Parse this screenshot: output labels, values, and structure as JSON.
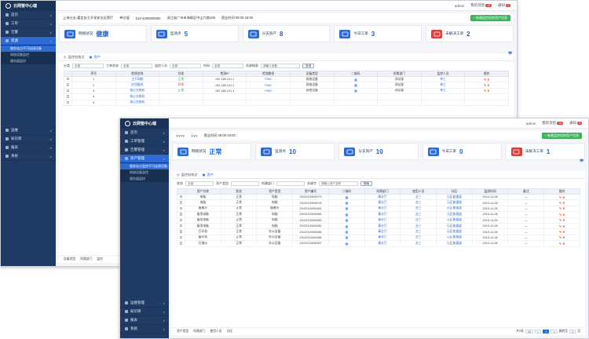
{
  "w1": {
    "logo": "云网管中心端",
    "nav": [
      {
        "label": "首页",
        "icon": "home-icon"
      },
      {
        "label": "工单",
        "icon": "ticket-icon"
      },
      {
        "label": "告警",
        "icon": "alarm-icon"
      },
      {
        "label": "资源",
        "icon": "resource-icon",
        "active": true
      }
    ],
    "sub": [
      "服务站点不可连接设备",
      "网络设备监控",
      "服务器监控"
    ],
    "nav_bottom": [
      {
        "label": "运维",
        "icon": "ops-icon"
      },
      {
        "label": "知识库",
        "icon": "book-icon"
      },
      {
        "label": "报表",
        "icon": "report-icon"
      },
      {
        "label": "系统",
        "icon": "settings-icon"
      }
    ],
    "topbar": {
      "user": "admin",
      "msg": "我的消息",
      "msg_badge": "15",
      "notice": "通知",
      "notice_badge": "9"
    },
    "info": {
      "org": "上海分支-嘉定自主开发安全运营厅",
      "role": "单位值",
      "phone": "010-4000000000",
      "addr": "浙江省广州市海珠区中山六路109",
      "hours": "营业时间 09:00-18:00",
      "add_button": "+ 新建监控机房资产信息"
    },
    "stats": [
      {
        "label": "网络状况",
        "value": "健康",
        "icon": "globe-icon",
        "color": "#2d6ad1"
      },
      {
        "label": "监测点",
        "value": "5",
        "icon": "monitor-icon",
        "color": "#2d6ad1"
      },
      {
        "label": "分支资产",
        "value": "8",
        "icon": "asset-icon",
        "color": "#2d6ad1"
      },
      {
        "label": "今日工单",
        "value": "3",
        "icon": "ticket-icon",
        "color": "#2d6ad1"
      },
      {
        "label": "未解决工单",
        "value": "2",
        "icon": "warning-ticket-icon",
        "color": "#e03c3c"
      }
    ],
    "tabs": [
      "监控机构点",
      "资产"
    ],
    "filters": {
      "f1": "分类",
      "v1": "全部",
      "f2": "工单状态",
      "v2": "全部",
      "f3": "监控人员",
      "v3": "全部",
      "f4": "时间",
      "v4": "全部",
      "f5": "资源搜索",
      "v5": "请输入设备",
      "query": "查询"
    },
    "columns": [
      "",
      "序号",
      "检测名称",
      "状态",
      "检测IP",
      "检测路径",
      "设备类型",
      "二维码",
      "所属部门",
      "监控人员",
      "操作"
    ],
    "rows": [
      {
        "no": "1",
        "name": "主干网络",
        "status": "正常",
        "ok": true,
        "ip": "192.168.101.1",
        "path": "PING",
        "type": "网络设备",
        "dept": "测试部",
        "person": "单工"
      },
      {
        "no": "2",
        "name": "应用服务",
        "status": "异常",
        "ok": false,
        "ip": "192.168.101.1",
        "path": "PING",
        "type": "网络设备",
        "dept": "测试部",
        "person": "单工"
      },
      {
        "no": "3",
        "name": "核心交换机",
        "status": "正常",
        "ok": true,
        "ip": "192.168.101.1",
        "path": "PING",
        "type": "网络设备",
        "dept": "测试部",
        "person": "单工"
      },
      {
        "no": "4",
        "name": "核心交换机",
        "status": "",
        "ok": true,
        "ip": "",
        "path": "",
        "type": "",
        "dept": "",
        "person": ""
      },
      {
        "no": "5",
        "name": "核心交换机",
        "status": "",
        "ok": true,
        "ip": "",
        "path": "",
        "type": "",
        "dept": "",
        "person": ""
      }
    ],
    "footer": [
      "设备类型",
      "所属部门",
      "监控"
    ]
  },
  "w2": {
    "logo": "云网管中心端",
    "nav": [
      {
        "label": "首页",
        "icon": "home-icon"
      },
      {
        "label": "工单管理",
        "icon": "ticket-icon"
      },
      {
        "label": "告警管理",
        "icon": "alarm-icon"
      },
      {
        "label": "资产管理",
        "icon": "resource-icon",
        "active": true
      }
    ],
    "sub": [
      "服务站点监控不可连接设备",
      "网络设备监控",
      "服务器监控"
    ],
    "nav_bottom": [
      {
        "label": "运维管理",
        "icon": "ops-icon"
      },
      {
        "label": "知识库",
        "icon": "book-icon"
      },
      {
        "label": "报表",
        "icon": "report-icon"
      },
      {
        "label": "系统",
        "icon": "settings-icon"
      }
    ],
    "topbar": {
      "user": "admin",
      "msg": "我的消息",
      "msg_badge": "15",
      "notice": "通知",
      "notice_badge": "9"
    },
    "info": {
      "org": "YYYY",
      "role": "YYY",
      "hours": "营业时间 09:00-18:00",
      "add_button": "+ 新建监控机房资产信息"
    },
    "stats": [
      {
        "label": "网络状况",
        "value": "正常",
        "icon": "globe-icon",
        "color": "#2d6ad1"
      },
      {
        "label": "监测点",
        "value": "10",
        "icon": "monitor-icon",
        "color": "#2d6ad1"
      },
      {
        "label": "分支资产",
        "value": "10",
        "icon": "asset-icon",
        "color": "#2d6ad1"
      },
      {
        "label": "今日工单",
        "value": "0",
        "icon": "ticket-icon",
        "color": "#2d6ad1"
      },
      {
        "label": "未解决工单",
        "value": "1",
        "icon": "warning-ticket-icon",
        "color": "#e03c3c"
      }
    ],
    "tabs": [
      "监控机构点",
      "资产"
    ],
    "filters": {
      "f1": "状态",
      "v1": "全部",
      "f2": "资产类型",
      "v2": "",
      "f3": "所属部门",
      "v3": "",
      "f4": "关键字",
      "v4": "请输入资产名称",
      "query": "搜索"
    },
    "columns": [
      "",
      "资产名称",
      "状态",
      "资产类型",
      "资产编号",
      "二维码",
      "所属部门",
      "使用人员",
      "分区",
      "监测时间",
      "备注",
      "操作"
    ],
    "rows": [
      {
        "no": "1",
        "name": "电脑",
        "status": "正常",
        "type": "电脑",
        "code": "ZHJ2019000079",
        "dept": "事业厅",
        "user": "业三",
        "zone": "元区复通道",
        "time": "2019-11-05",
        "note": "—"
      },
      {
        "no": "2",
        "name": "电脑",
        "status": "正常",
        "type": "电脑",
        "code": "ZHJ2019000078",
        "dept": "事业厅",
        "user": "业三",
        "zone": "元区复通道",
        "time": "2019-11-05",
        "note": "—"
      },
      {
        "no": "3",
        "name": "摄像头",
        "status": "正常",
        "type": "摄像头",
        "code": "ZHJ2019000081",
        "dept": "事业厅",
        "user": "业三",
        "zone": "元区复通道",
        "time": "2019-11-05",
        "note": "—"
      },
      {
        "no": "4",
        "name": "备用电脑",
        "status": "正常",
        "type": "电脑",
        "code": "ZHJ2019000080",
        "dept": "事业厅",
        "user": "业三",
        "zone": "元区复通道",
        "time": "2019-11-05",
        "note": "—"
      },
      {
        "no": "5",
        "name": "备用电脑",
        "status": "正常",
        "type": "电脑",
        "code": "ZHJ2019000083",
        "dept": "事业厅",
        "user": "业三",
        "zone": "元区复通道",
        "time": "2019-11-05",
        "note": "—"
      },
      {
        "no": "6",
        "name": "备用电脑",
        "status": "正常",
        "type": "电脑",
        "code": "ZHJ2019000082",
        "dept": "事业厅",
        "user": "业三",
        "zone": "元区复通道",
        "time": "2019-11-05",
        "note": "—"
      },
      {
        "no": "7",
        "name": "打印机",
        "status": "正常",
        "type": "办公设备",
        "code": "ZHJ2019000085",
        "dept": "事业厅",
        "user": "业三",
        "zone": "元区复通道",
        "time": "2019-11-05",
        "note": "—"
      },
      {
        "no": "8",
        "name": "备印机",
        "status": "正常",
        "type": "办公设备",
        "code": "ZHJ2019000086",
        "dept": "事业厅",
        "user": "业三",
        "zone": "元区复通道",
        "time": "2019-11-05",
        "note": "—"
      },
      {
        "no": "9",
        "name": "扫描仪",
        "status": "正常",
        "type": "办公设备",
        "code": "ZHJ2019000087",
        "dept": "事业厅",
        "user": "业三",
        "zone": "元区复通道",
        "time": "2019-11-05",
        "note": "—"
      }
    ],
    "footer": [
      "资产类型",
      "所属部门",
      "使用人员",
      "分区"
    ],
    "pager": {
      "total": "共9条",
      "per": "每页10条",
      "size": "10",
      "prev": "<",
      "cur": "1",
      "next": ">",
      "goto": "跳转至",
      "page": "1",
      "unit": "页"
    }
  }
}
